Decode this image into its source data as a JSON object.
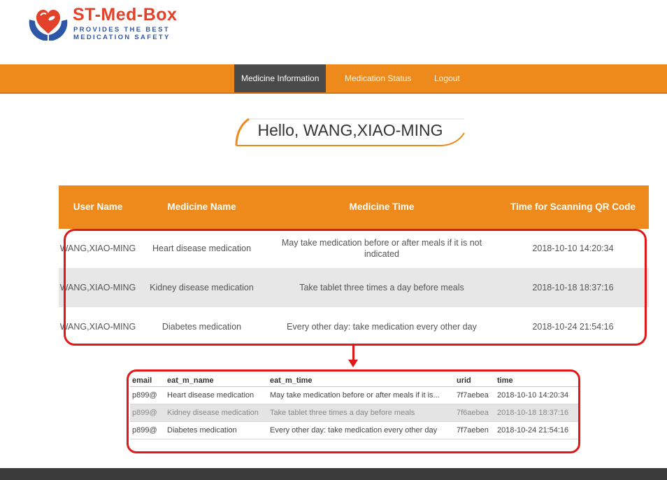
{
  "brand": {
    "name": "ST-Med-Box",
    "tagline_line1": "PROVIDES THE BEST",
    "tagline_line2": "MEDICATION SAFETY",
    "colors": {
      "title": "#e2412a",
      "tagline": "#2f57a8",
      "nav": "#ee8a1c",
      "highlight": "#e01818"
    }
  },
  "nav": {
    "items": [
      {
        "label": "Medicine Information",
        "active": true
      },
      {
        "label": "Medication Status",
        "active": false
      },
      {
        "label": "Logout",
        "active": false
      }
    ]
  },
  "greeting": "Hello, WANG,XIAO-MING",
  "main_table": {
    "headers": [
      "User Name",
      "Medicine Name",
      "Medicine Time",
      "Time for Scanning QR Code"
    ],
    "rows": [
      {
        "user": "WANG,XIAO-MING",
        "medicine": "Heart disease medication",
        "time": "May take medication before or after meals if it is not indicated",
        "scanned": "2018-10-10 14:20:34"
      },
      {
        "user": "WANG,XIAO-MING",
        "medicine": "Kidney disease medication",
        "time": "Take tablet three times a day before meals",
        "scanned": "2018-10-18 18:37:16"
      },
      {
        "user": "WANG,XIAO-MING",
        "medicine": "Diabetes medication",
        "time": "Every other day: take medication every other day",
        "scanned": "2018-10-24 21:54:16"
      }
    ]
  },
  "db_table": {
    "headers": [
      "email",
      "eat_m_name",
      "eat_m_time",
      "urid",
      "time"
    ],
    "rows": [
      {
        "email": "p899@",
        "name": "Heart disease medication",
        "time": "May take medication before or after meals if it is...",
        "urid": "7f7aebea",
        "stamp": "2018-10-10 14:20:34"
      },
      {
        "email": "p899@",
        "name": "Kidney disease medication",
        "time": "Take tablet three times a day before meals",
        "urid": "7f6aebea",
        "stamp": "2018-10-18 18:37:16"
      },
      {
        "email": "p899@",
        "name": "Diabetes medication",
        "time": "Every other day: take medication every other day",
        "urid": "7f7aeben",
        "stamp": "2018-10-24 21:54:16"
      }
    ]
  }
}
